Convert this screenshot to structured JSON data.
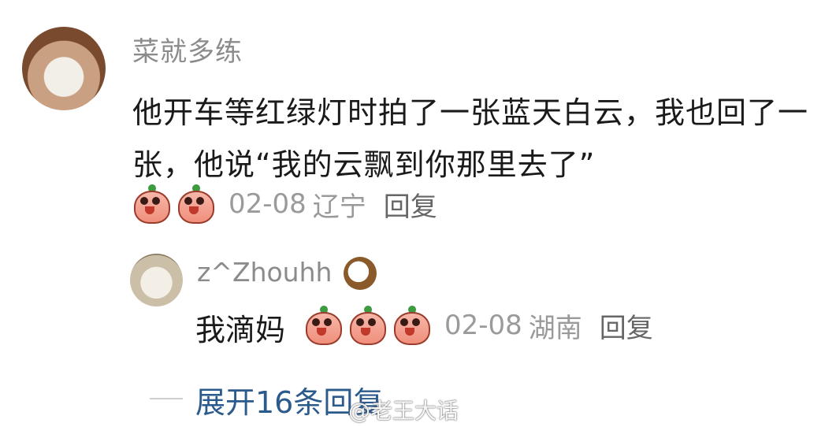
{
  "main_comment": {
    "username": "菜就多练",
    "text": "他开车等红绿灯时拍了一张蓝天白云，我也回了一张，他说“我的云飘到你那里去了”",
    "date": "02-08",
    "location": "辽宁",
    "reply_label": "回复",
    "emoji_count": 2
  },
  "sub_comment": {
    "username": "z^Zhouhh",
    "username_icon": "coconut-icon",
    "text": "我滴妈",
    "date": "02-08",
    "location": "湖南",
    "reply_label": "回复",
    "emoji_count": 3
  },
  "expand": {
    "label": "展开16条回复"
  },
  "watermark": {
    "text": "@老王大话"
  },
  "colors": {
    "username": "#8b8b8b",
    "link": "#2b5a8c",
    "text": "#1a1a1a"
  }
}
